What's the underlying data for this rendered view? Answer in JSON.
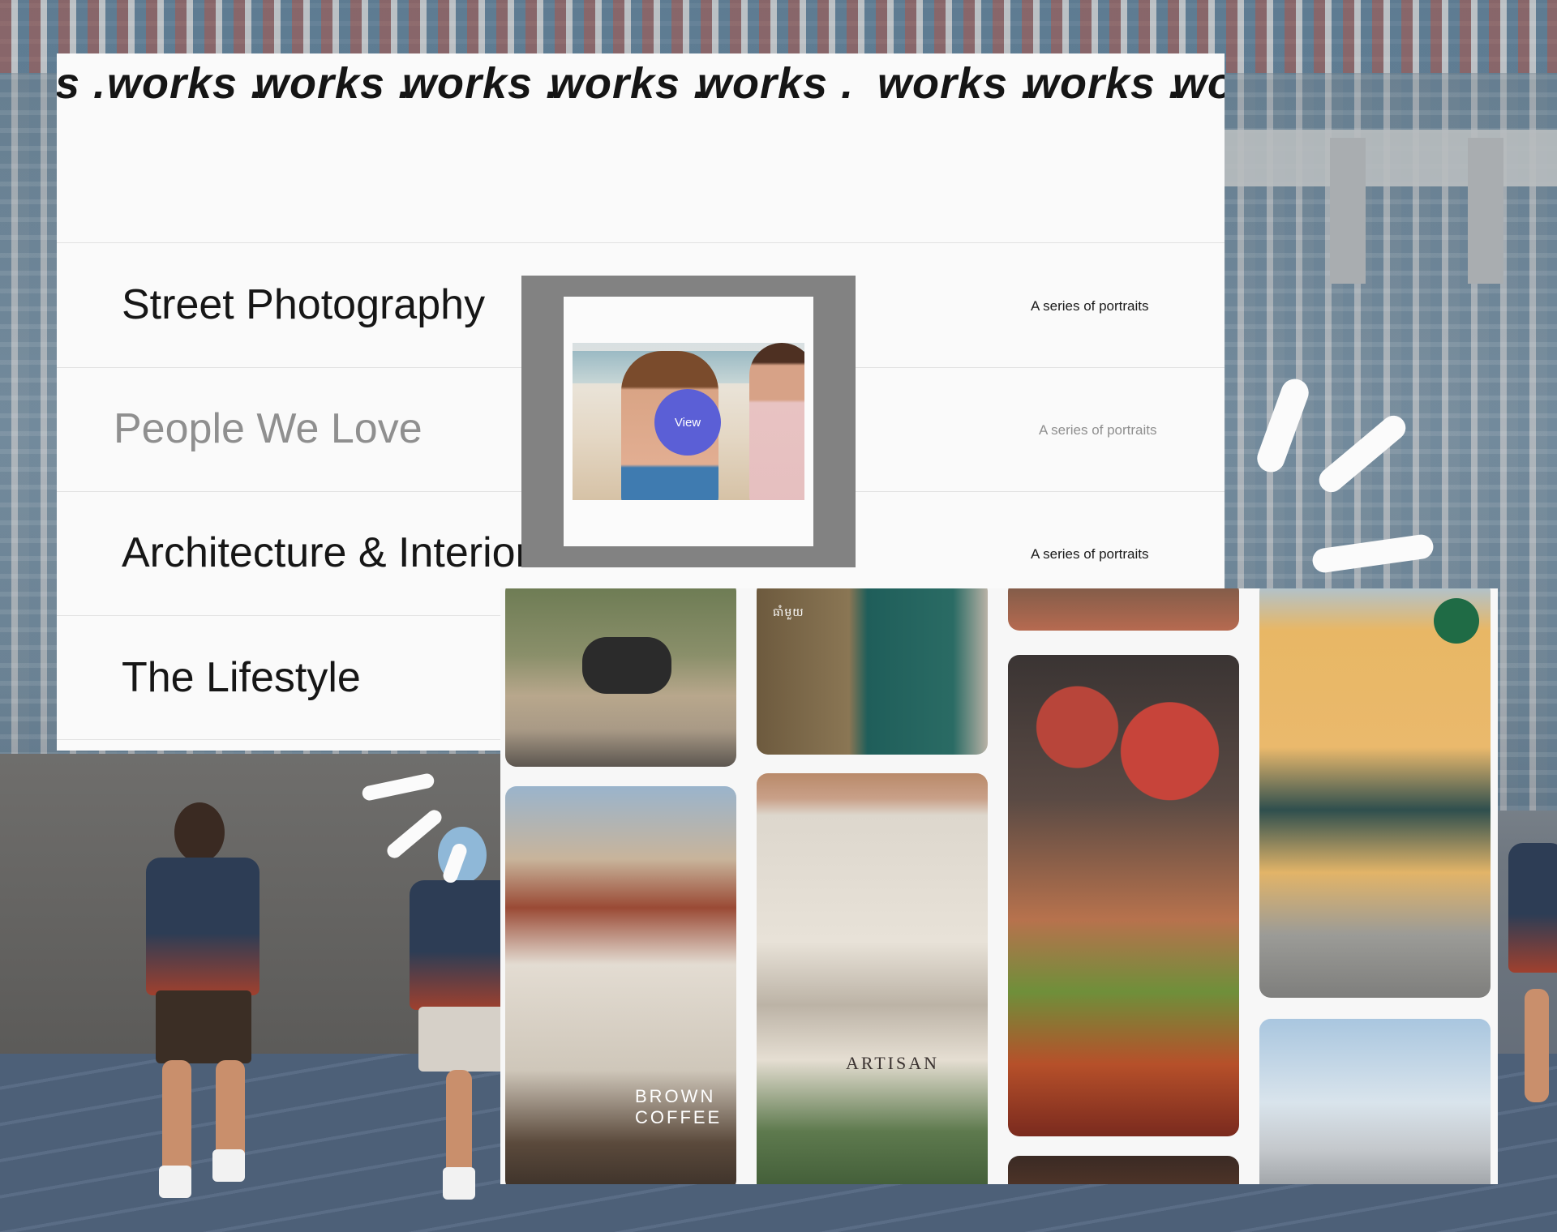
{
  "marquee": {
    "words": [
      "s .",
      "works .",
      "works .",
      "works .",
      "works .",
      "works .",
      "works .",
      "works .",
      "wo"
    ]
  },
  "list": {
    "rows": [
      {
        "title": "Street Photography",
        "subtitle": "A series of portraits",
        "state": "normal"
      },
      {
        "title": "People We Love",
        "subtitle": "A series of portraits",
        "state": "hover"
      },
      {
        "title": "Architecture & Interiors",
        "subtitle": "A series of portraits",
        "state": "normal"
      },
      {
        "title": "The Lifestyle",
        "subtitle": "",
        "state": "normal"
      }
    ]
  },
  "preview": {
    "button_label": "View",
    "button_color": "#5b5fd6"
  },
  "gallery": {
    "captions": {
      "brown_coffee": "BROWN COFFEE",
      "artisan": "ARTISAN",
      "shop_sign": "ធាំមួយ"
    },
    "tiles": [
      {
        "subject": "motorcycle-street"
      },
      {
        "subject": "shop-front-green-door"
      },
      {
        "subject": "bowl-closeup"
      },
      {
        "subject": "market-vendor"
      },
      {
        "subject": "yellow-colonial-cafe"
      },
      {
        "subject": "brown-coffee-building"
      },
      {
        "subject": "artisan-arcade-building"
      },
      {
        "subject": "sky-power-lines"
      },
      {
        "subject": "market-bottom"
      }
    ]
  },
  "colors": {
    "card_bg": "#fafafa",
    "text_primary": "#161616",
    "text_muted": "#8f8f8f",
    "accent": "#5b5fd6"
  }
}
